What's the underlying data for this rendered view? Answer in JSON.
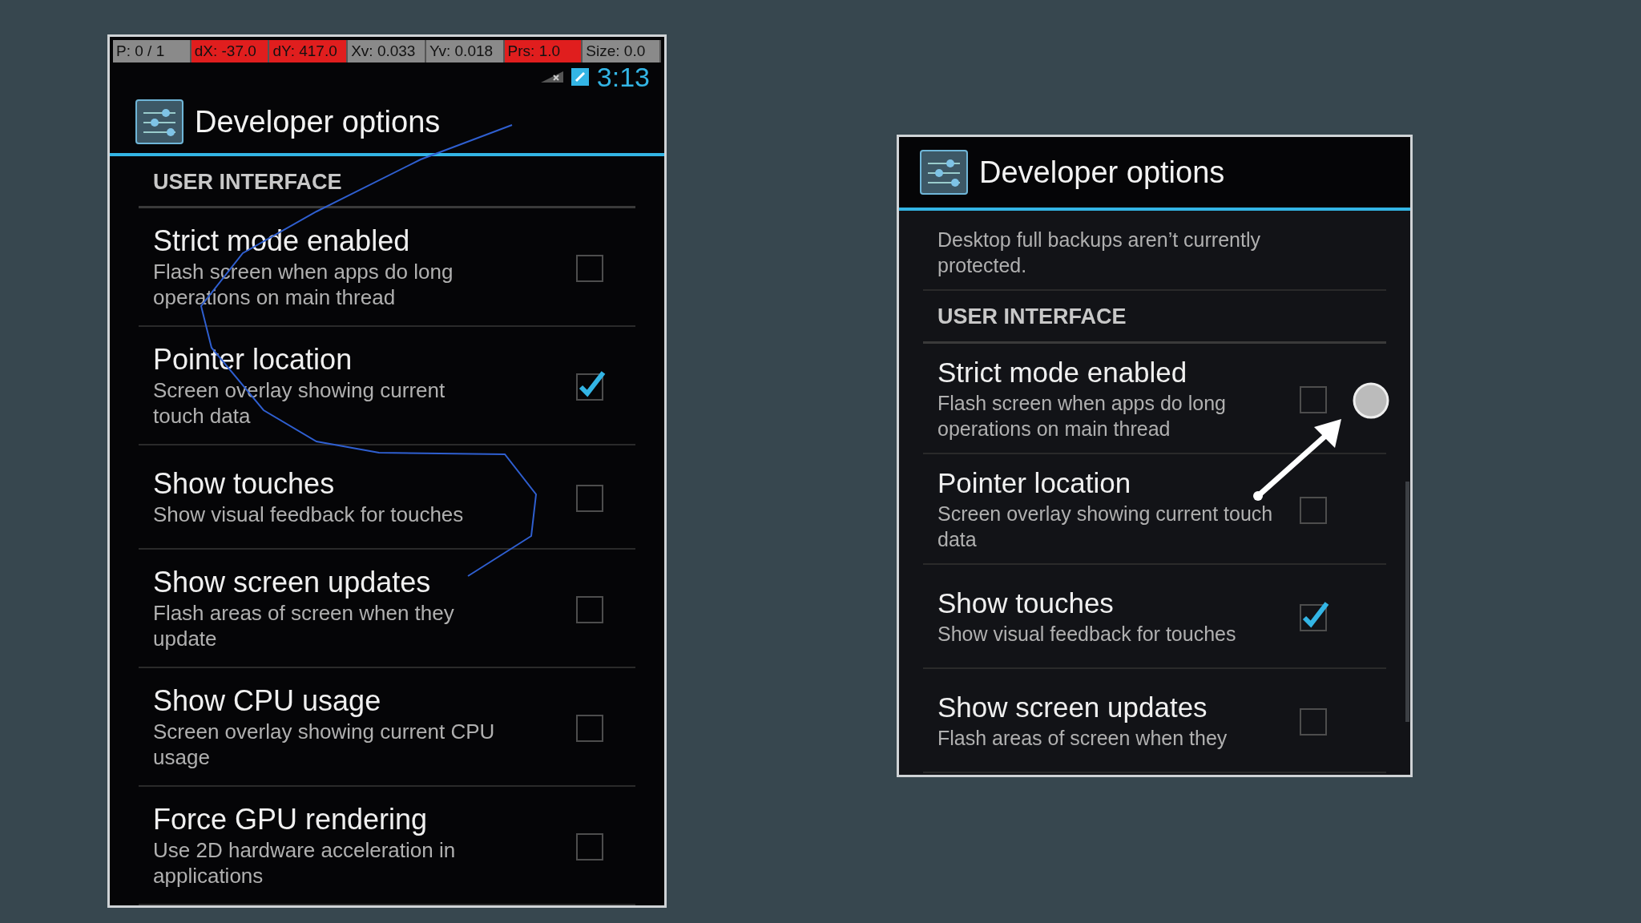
{
  "phones": [
    {
      "status_bar": {
        "cells": [
          {
            "text": "P: 0 / 1",
            "highlight": false
          },
          {
            "text": "dX: -37.0",
            "highlight": true
          },
          {
            "text": "dY: 417.0",
            "highlight": true
          },
          {
            "text": "Xv: 0.033",
            "highlight": false
          },
          {
            "text": "Yv: 0.018",
            "highlight": false
          },
          {
            "text": "Prs: 1.0",
            "highlight": true
          },
          {
            "text": "Size: 0.0",
            "highlight": false
          }
        ],
        "clock": "3:13"
      },
      "title": "Developer options",
      "trace": true,
      "items": [
        {
          "kind": "section",
          "title": "USER INTERFACE"
        },
        {
          "kind": "setting",
          "title": "Strict mode enabled",
          "summary": "Flash screen when apps do long operations on main thread",
          "checked": false
        },
        {
          "kind": "setting",
          "title": "Pointer location",
          "summary": "Screen overlay showing current touch data",
          "checked": true
        },
        {
          "kind": "setting",
          "title": "Show touches",
          "summary": "Show visual feedback for touches",
          "checked": false
        },
        {
          "kind": "setting",
          "title": "Show screen updates",
          "summary": "Flash areas of screen when they update",
          "checked": false
        },
        {
          "kind": "setting",
          "title": "Show CPU usage",
          "summary": "Screen overlay showing current CPU usage",
          "checked": false
        },
        {
          "kind": "setting",
          "title": "Force GPU rendering",
          "summary": "Use 2D hardware acceleration in applications",
          "checked": false
        }
      ]
    },
    {
      "title": "Developer options",
      "trace": false,
      "items": [
        {
          "kind": "partial",
          "summary": "Desktop full backups aren’t currently protected."
        },
        {
          "kind": "section",
          "title": "USER INTERFACE"
        },
        {
          "kind": "setting",
          "title": "Strict mode enabled",
          "summary": "Flash screen when apps do long operations on main thread",
          "checked": false
        },
        {
          "kind": "setting",
          "title": "Pointer location",
          "summary": "Screen overlay showing current touch data",
          "checked": false
        },
        {
          "kind": "setting",
          "title": "Show touches",
          "summary": "Show visual feedback for touches",
          "checked": true
        },
        {
          "kind": "setting",
          "title": "Show screen updates",
          "summary": "Flash areas of screen when they",
          "checked": false
        }
      ]
    }
  ]
}
